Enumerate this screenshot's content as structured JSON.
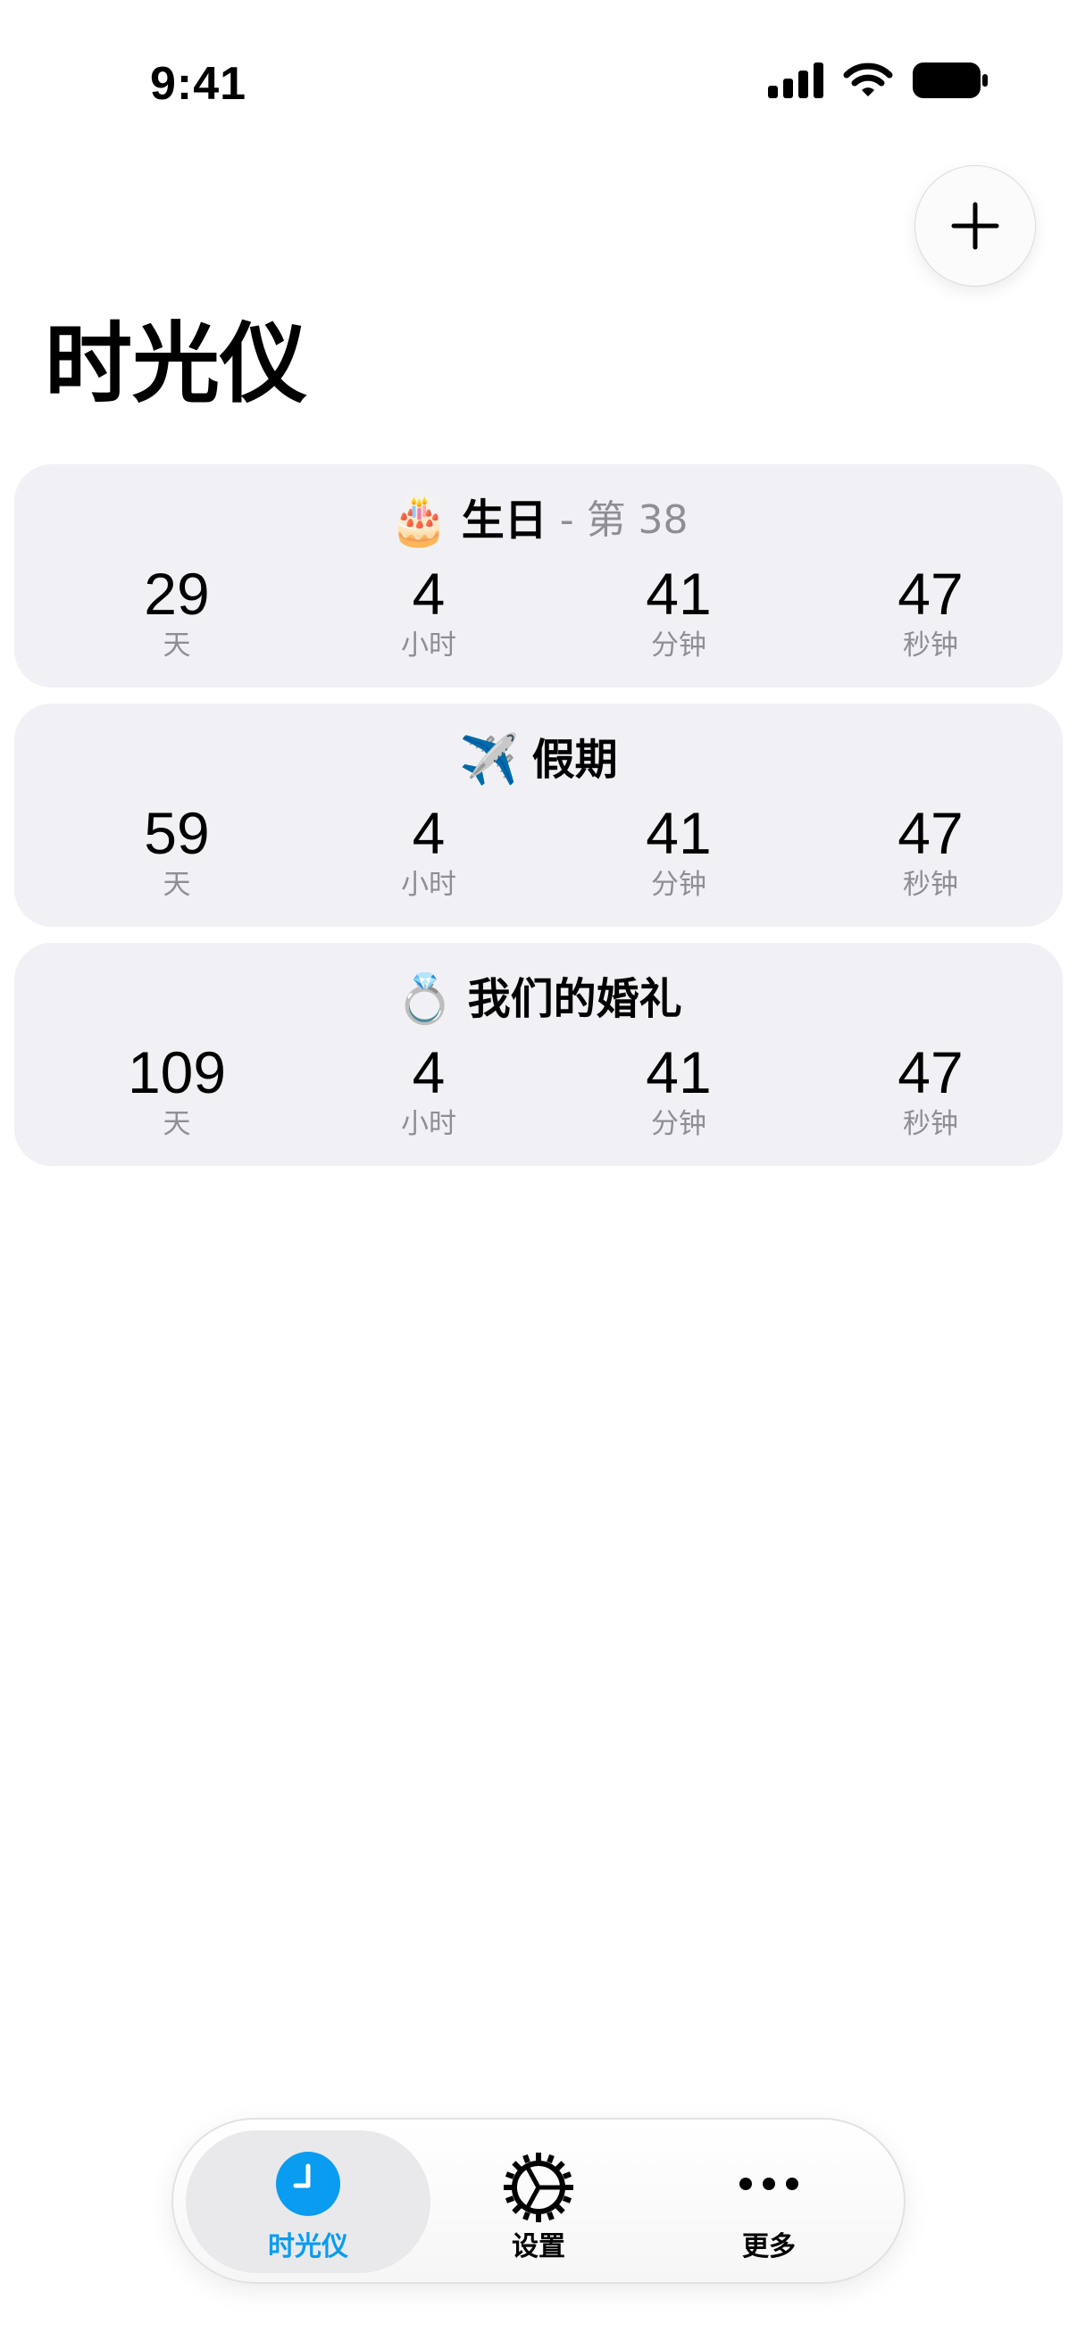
{
  "status_bar": {
    "time": "9:41",
    "icons": [
      "signal-icon",
      "wifi-icon",
      "battery-icon"
    ]
  },
  "header": {
    "add_icon": "plus-icon",
    "title": "时光仪"
  },
  "events": [
    {
      "emoji": "🎂",
      "title": "生日",
      "subtitle": "- 第 38",
      "days": "29",
      "hours": "4",
      "minutes": "41",
      "seconds": "47",
      "unit_labels": {
        "days": "天",
        "hours": "小时",
        "minutes": "分钟",
        "seconds": "秒钟"
      }
    },
    {
      "emoji": "✈️",
      "title": "假期",
      "subtitle": "",
      "days": "59",
      "hours": "4",
      "minutes": "41",
      "seconds": "47",
      "unit_labels": {
        "days": "天",
        "hours": "小时",
        "minutes": "分钟",
        "seconds": "秒钟"
      }
    },
    {
      "emoji": "💍",
      "title": "我们的婚礼",
      "subtitle": "",
      "days": "109",
      "hours": "4",
      "minutes": "41",
      "seconds": "47",
      "unit_labels": {
        "days": "天",
        "hours": "小时",
        "minutes": "分钟",
        "seconds": "秒钟"
      }
    }
  ],
  "tab_bar": {
    "tabs": [
      {
        "label": "时光仪",
        "icon": "clock-icon",
        "active": true
      },
      {
        "label": "设置",
        "icon": "gear-icon",
        "active": false
      },
      {
        "label": "更多",
        "icon": "more-icon",
        "active": false
      }
    ],
    "colors": {
      "active": "#0a9cf0",
      "inactive": "#000000"
    }
  }
}
